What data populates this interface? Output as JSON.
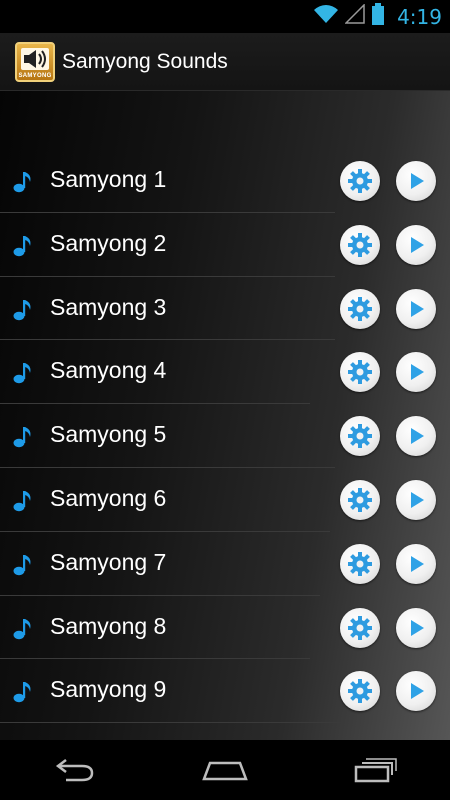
{
  "status_bar": {
    "time": "4:19",
    "icons": [
      "wifi-icon",
      "signal-icon",
      "battery-icon"
    ]
  },
  "action_bar": {
    "title": "Samyong Sounds",
    "logo_text": "SAMYONG"
  },
  "sounds": [
    {
      "label": "Samyong 1"
    },
    {
      "label": "Samyong 2"
    },
    {
      "label": "Samyong 3"
    },
    {
      "label": "Samyong 4"
    },
    {
      "label": "Samyong 5"
    },
    {
      "label": "Samyong 6"
    },
    {
      "label": "Samyong 7"
    },
    {
      "label": "Samyong 8"
    },
    {
      "label": "Samyong 9"
    }
  ],
  "nav_bar": {
    "buttons": [
      "back-icon",
      "home-icon",
      "recents-icon"
    ]
  },
  "colors": {
    "accent": "#33b5e5",
    "note": "#1e9be8",
    "gear": "#2e9be0",
    "play": "#2fa2e6"
  }
}
